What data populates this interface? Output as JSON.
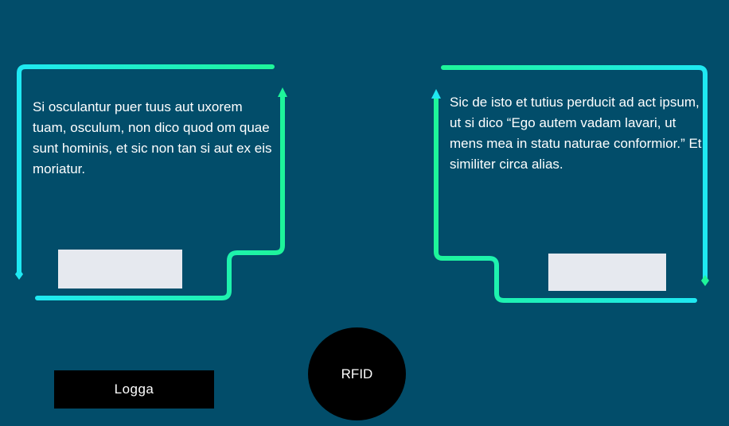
{
  "theme": {
    "background": "#024d6a",
    "accent_cyan": "#1fe8f2",
    "accent_green": "#1ef59a",
    "placeholder": "#e6e9ef",
    "button": "#000000",
    "text": "#ffffff"
  },
  "panels": {
    "left": {
      "text": "Si osculantur puer tuus aut uxorem tuam, osculum, non dico quod om quae sunt hominis, et sic non tan si aut ex eis moriatur."
    },
    "right": {
      "text": "Sic de isto et tutius perducit ad act ipsum, ut si dico “Ego autem vadam lavari, ut mens mea in statu naturae conformior.” Et similiter circa alias."
    }
  },
  "controls": {
    "login_label": "Logga",
    "rfid_label": "RFID"
  }
}
